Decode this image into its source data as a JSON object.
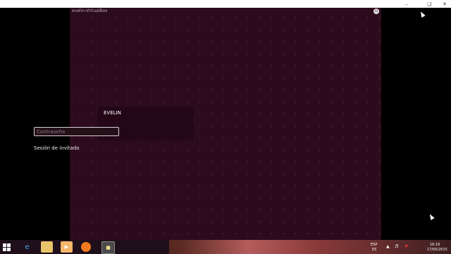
{
  "vm_window": {
    "title": "evelin-VirtualBox"
  },
  "login": {
    "username": "EVELIN",
    "password_placeholder": "Contraseña",
    "guest_session_label": "Sesión de invitado"
  },
  "host_window_controls": [
    "minimize-icon",
    "restore-icon",
    "close-icon"
  ],
  "taskbar": {
    "icons": [
      "windows-start-icon",
      "internet-explorer-icon",
      "file-explorer-icon",
      "media-player-icon",
      "firefox-icon",
      "virtualbox-icon"
    ],
    "tray": {
      "language_top": "ESP",
      "language_bottom": "ES",
      "time": "16:16",
      "date": "17/05/2015"
    }
  },
  "colors": {
    "vm_background": "#2c0b1c",
    "taskbar_dark": "#1f0f1a"
  }
}
